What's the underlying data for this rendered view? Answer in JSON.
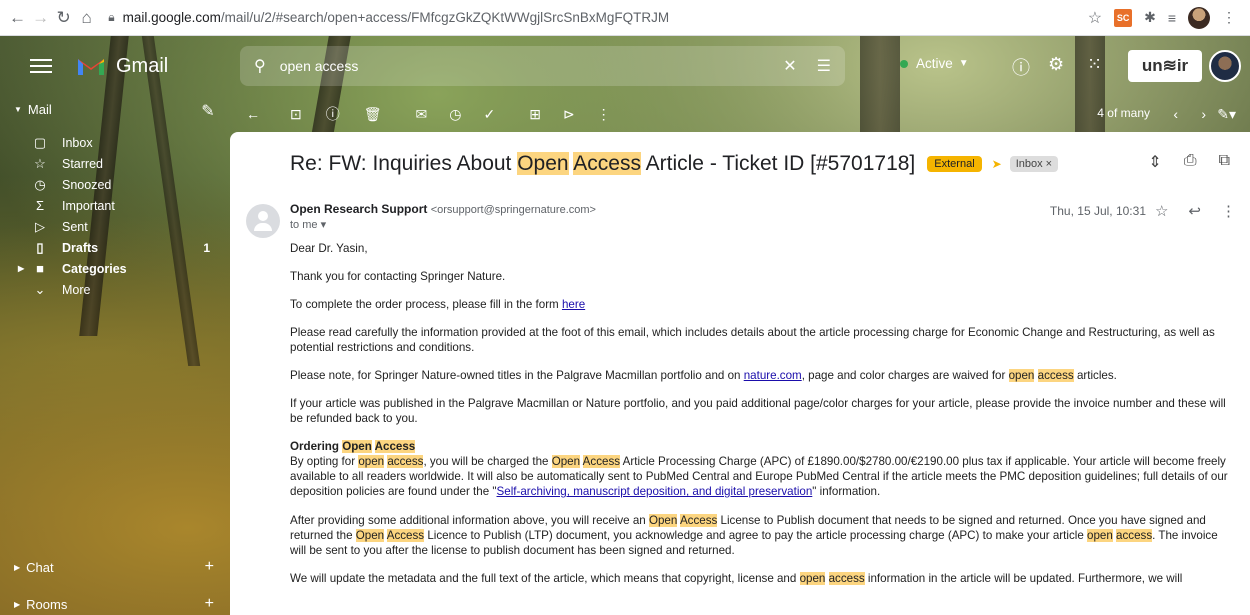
{
  "browser": {
    "url_domain": "mail.google.com",
    "url_path": "/mail/u/2/#search/open+access/FMfcgzGkZQKtWWgjlSrcSnBxMgFQTRJM",
    "ext_label": "SC"
  },
  "header": {
    "app_name": "Gmail",
    "search_value": "open access",
    "status": "Active",
    "org_logo": "un≋ir"
  },
  "sidebar": {
    "section": "Mail",
    "items": [
      {
        "label": "Inbox",
        "icon": "inbox-icon",
        "glyph": "▢"
      },
      {
        "label": "Starred",
        "icon": "star-icon",
        "glyph": "☆"
      },
      {
        "label": "Snoozed",
        "icon": "clock-icon",
        "glyph": "◷"
      },
      {
        "label": "Important",
        "icon": "important-icon",
        "glyph": "Σ"
      },
      {
        "label": "Sent",
        "icon": "send-icon",
        "glyph": "▷"
      },
      {
        "label": "Drafts",
        "icon": "draft-icon",
        "glyph": "▯",
        "count": "1"
      },
      {
        "label": "Categories",
        "icon": "label-icon",
        "glyph": "■"
      },
      {
        "label": "More",
        "icon": "chevron-down-icon",
        "glyph": "⌄"
      }
    ],
    "chat": "Chat",
    "rooms": "Rooms"
  },
  "toolbar": {
    "pager": "4 of many"
  },
  "email": {
    "subject_parts": [
      "Re: FW: Inquiries About ",
      "Open",
      " ",
      "Access",
      " Article - Ticket ID [#5701718]"
    ],
    "label_external": "External",
    "label_inbox": "Inbox ×",
    "sender_name": "Open Research Support",
    "sender_email": "<orsupport@springernature.com>",
    "to": "to me ▾",
    "date": "Thu, 15 Jul, 10:31",
    "greeting": "Dear Dr. Yasin,",
    "p1": "Thank you for contacting Springer Nature.",
    "p2_text": "To complete the order process, please fill in the form ",
    "p2_link": "here",
    "p3": "Please read carefully the information provided at the foot of this email, which includes details about the article processing charge for Economic Change and Restructuring, as well as potential restrictions and conditions.",
    "p4_a": "Please note, for Springer Nature-owned titles in the Palgrave Macmillan portfolio and on ",
    "p4_link": "nature.com",
    "p4_b": ", page and color charges are waived for ",
    "p4_hl1": "open",
    "p4_hl2": "access",
    "p4_c": " articles.",
    "p5": "If your article was published in the Palgrave Macmillan or Nature portfolio, and you paid additional page/color charges for your article, please provide the invoice number and these will be refunded back to you.",
    "h_ordering_a": "Ordering ",
    "h_ordering_hl1": "Open",
    "h_ordering_hl2": "Access",
    "p6_a": "By opting for ",
    "p6_hl1": "open",
    "p6_hl2": "access",
    "p6_b": ", you will be charged the ",
    "p6_hl3": "Open",
    "p6_hl4": "Access",
    "p6_c": " Article Processing Charge (APC) of £1890.00/$2780.00/€2190.00 plus tax if applicable. Your article will become freely available to all readers worldwide. It will also be automatically sent to PubMed Central and Europe PubMed Central if the article meets the PMC deposition guidelines; full details of our deposition policies are found under the \"",
    "p6_link": "Self-archiving, manuscript deposition, and digital preservation",
    "p6_d": "\" information.",
    "p7_a": "After providing some additional information above, you will receive an ",
    "p7_hl1": "Open",
    "p7_hl2": "Access",
    "p7_b": " License to Publish document that needs to be signed and returned. Once you have signed and returned the ",
    "p7_hl3": "Open",
    "p7_hl4": "Access",
    "p7_c": " Licence to Publish (LTP) document, you acknowledge and agree to pay the article processing charge (APC) to make your article ",
    "p7_hl5": "open",
    "p7_hl6": "access",
    "p7_d": ". The invoice will be sent to you after the license to publish document has been signed and returned.",
    "p8_a": "We will update the metadata and the full text of the article, which means that copyright, license and ",
    "p8_hl1": "open",
    "p8_hl2": "access",
    "p8_b": " information in the article will be updated. Furthermore, we will"
  }
}
